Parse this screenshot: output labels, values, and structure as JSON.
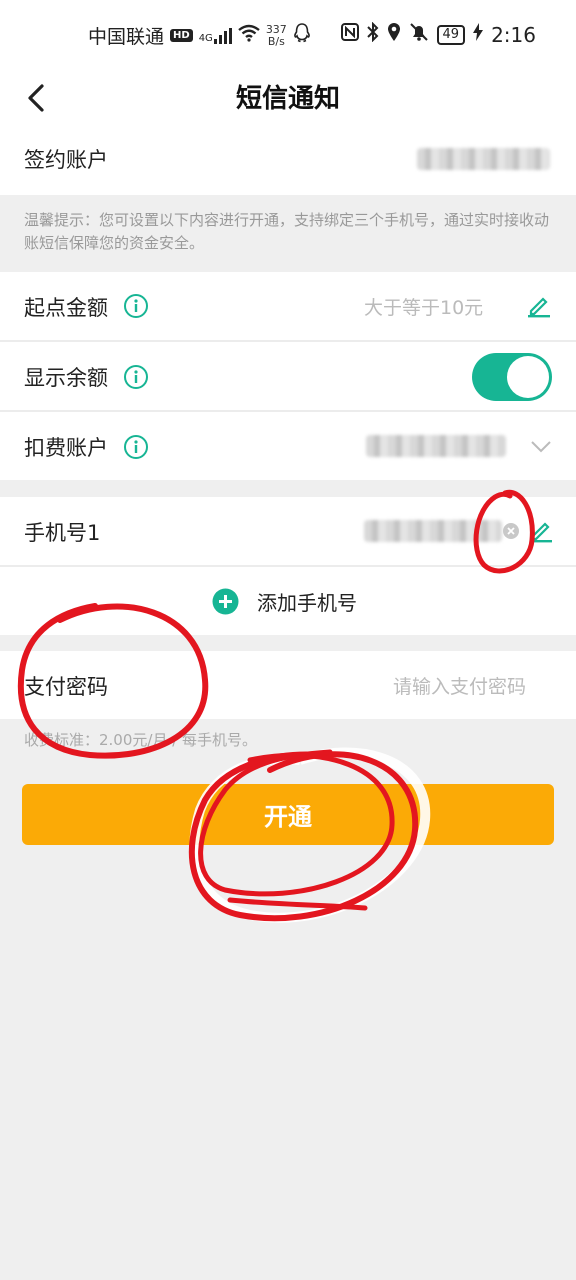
{
  "status_bar": {
    "carrier": "中国联通",
    "hd": "HD",
    "network": "4G",
    "speed_value": "337",
    "speed_unit": "B/s",
    "battery": "49",
    "time": "2:16"
  },
  "header": {
    "title": "短信通知",
    "back_icon": "chevron-left-icon"
  },
  "account": {
    "label": "签约账户"
  },
  "tip": {
    "text": "温馨提示：您可设置以下内容进行开通，支持绑定三个手机号，通过实时接收动账短信保障您的资金安全。"
  },
  "threshold": {
    "label": "起点金额",
    "placeholder": "大于等于10元",
    "icon": "edit-pencil-icon"
  },
  "show_balance": {
    "label": "显示余额",
    "enabled": true
  },
  "fee_account": {
    "label": "扣费账户",
    "icon": "chevron-down-icon"
  },
  "phone1": {
    "label": "手机号1",
    "clear_icon": "clear-circle-icon",
    "edit_icon": "edit-pencil-icon"
  },
  "add_phone": {
    "label": "添加手机号",
    "icon": "plus-circle-icon"
  },
  "pay_password": {
    "label": "支付密码",
    "placeholder": "请输入支付密码"
  },
  "fee_note": {
    "text": "收费标准：2.00元/月 / 每手机号。"
  },
  "submit": {
    "label": "开通"
  },
  "colors": {
    "accent_green": "#17b594",
    "button_orange": "#fbaa06",
    "annotation_red": "#e3161f"
  }
}
